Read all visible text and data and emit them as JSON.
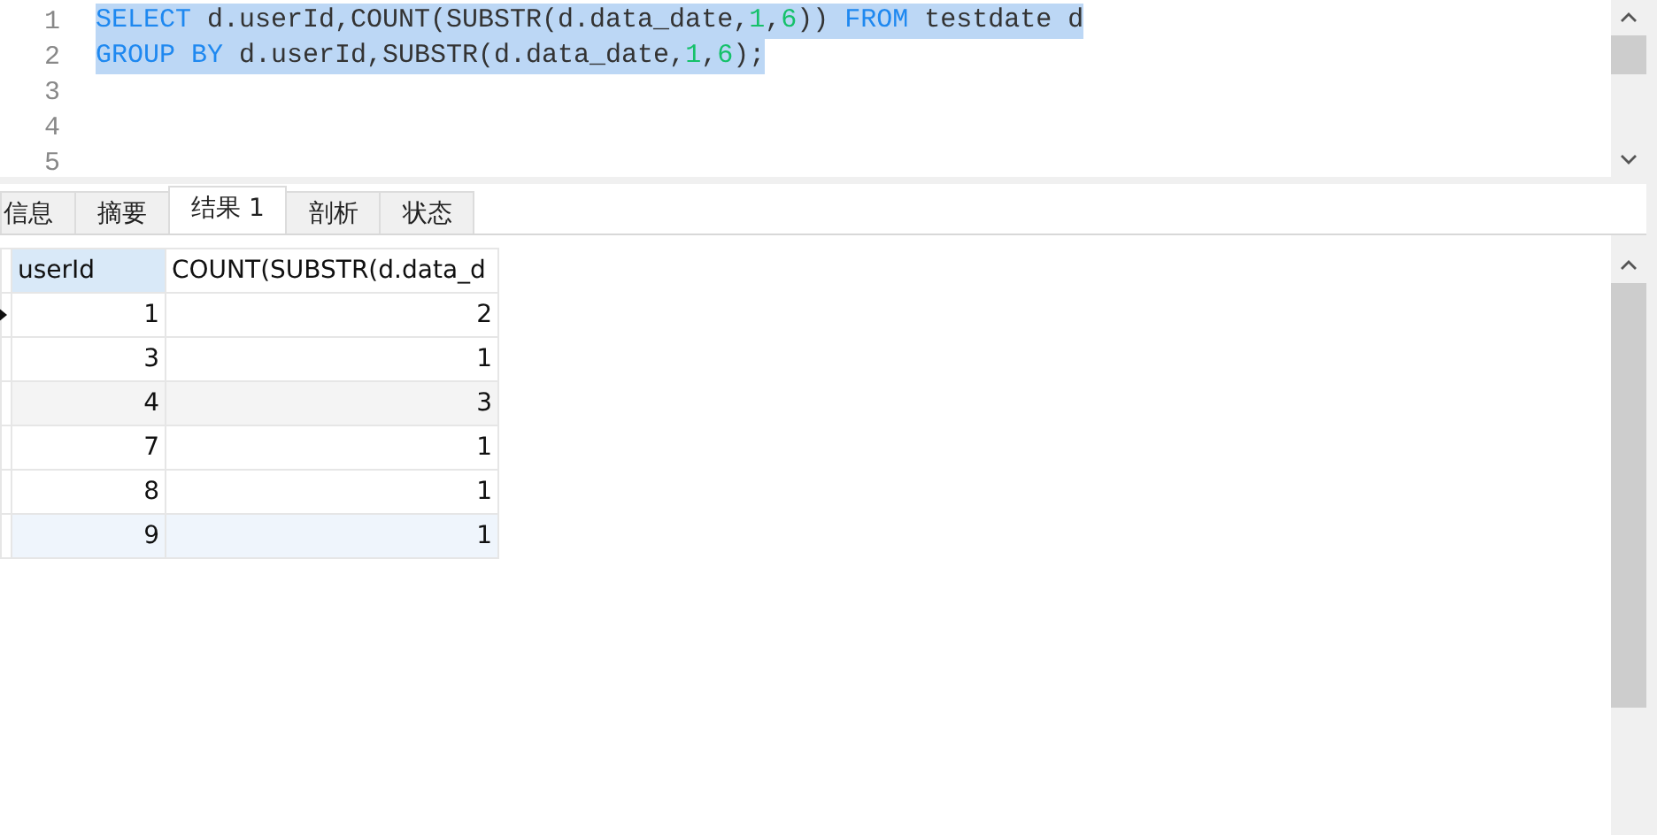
{
  "editor": {
    "lines": [
      {
        "number": "1",
        "selected": true,
        "tokens": [
          {
            "kind": "keyword",
            "text": "SELECT"
          },
          {
            "kind": "plain",
            "text": " d.userId,COUNT(SUBSTR(d.data_date,"
          },
          {
            "kind": "number",
            "text": "1"
          },
          {
            "kind": "plain",
            "text": ","
          },
          {
            "kind": "number",
            "text": "6"
          },
          {
            "kind": "plain",
            "text": ")) "
          },
          {
            "kind": "keyword",
            "text": "FROM"
          },
          {
            "kind": "plain",
            "text": " testdate d"
          }
        ]
      },
      {
        "number": "2",
        "selected": true,
        "tokens": [
          {
            "kind": "keyword",
            "text": "GROUP BY"
          },
          {
            "kind": "plain",
            "text": " d.userId,SUBSTR(d.data_date,"
          },
          {
            "kind": "number",
            "text": "1"
          },
          {
            "kind": "plain",
            "text": ","
          },
          {
            "kind": "number",
            "text": "6"
          },
          {
            "kind": "plain",
            "text": ");"
          }
        ]
      },
      {
        "number": "3"
      },
      {
        "number": "4"
      },
      {
        "number": "5"
      }
    ]
  },
  "tabs": [
    {
      "label": "信息",
      "selected": false
    },
    {
      "label": "摘要",
      "selected": false
    },
    {
      "label": "结果 1",
      "selected": true
    },
    {
      "label": "剖析",
      "selected": false
    },
    {
      "label": "状态",
      "selected": false
    }
  ],
  "table": {
    "columns": [
      "userId",
      "COUNT(SUBSTR(d.data_d"
    ],
    "rows": [
      {
        "selected": true,
        "kind": "plain",
        "cells": [
          "1",
          "2"
        ]
      },
      {
        "selected": false,
        "kind": "plain",
        "cells": [
          "3",
          "1"
        ]
      },
      {
        "selected": false,
        "kind": "shaded",
        "cells": [
          "4",
          "3"
        ]
      },
      {
        "selected": false,
        "kind": "plain",
        "cells": [
          "7",
          "1"
        ]
      },
      {
        "selected": false,
        "kind": "plain",
        "cells": [
          "8",
          "1"
        ]
      },
      {
        "selected": false,
        "kind": "hovered",
        "cells": [
          "9",
          "1"
        ]
      }
    ]
  }
}
